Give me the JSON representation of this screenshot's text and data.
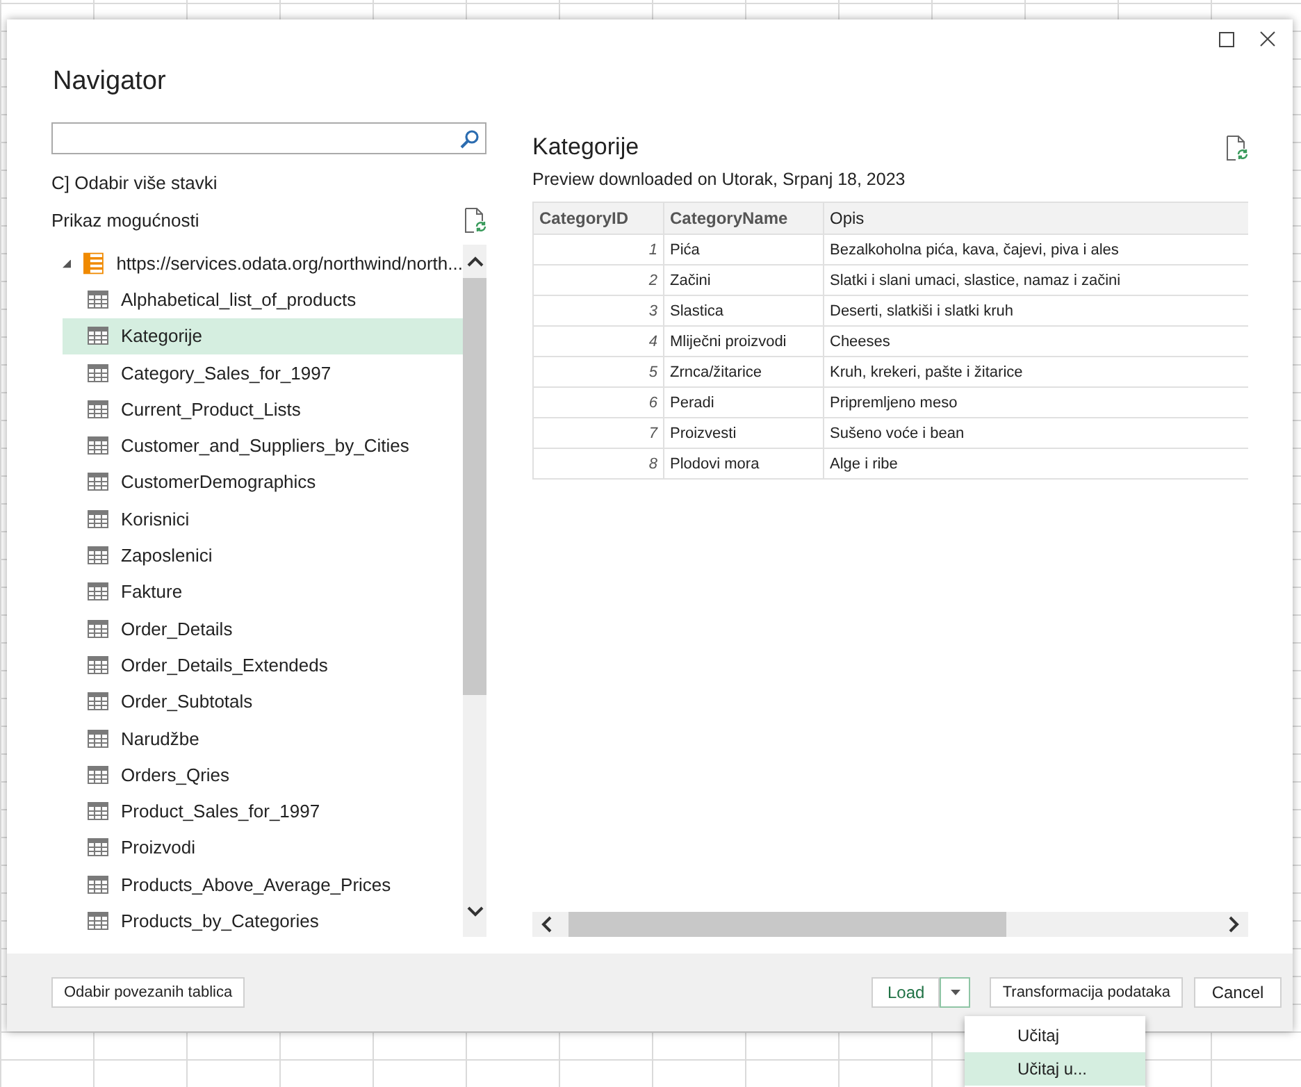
{
  "window": {
    "title": "Navigator"
  },
  "navigator": {
    "multi_select_label": "C] Odabir više stavki",
    "display_options_label": "Prikaz mogućnosti",
    "tree": {
      "label": "https://services.odata.org/northwind/north...",
      "expanded": true,
      "children": [
        {
          "label": "Alphabetical_list_of_products",
          "selected": false
        },
        {
          "label": "Kategorije",
          "selected": true
        },
        {
          "label": "Category_Sales_for_1997",
          "selected": false
        },
        {
          "label": "Current_Product_Lists",
          "selected": false
        },
        {
          "label": "Customer_and_Suppliers_by_Cities",
          "selected": false
        },
        {
          "label": "CustomerDemographics",
          "selected": false
        },
        {
          "label": "Korisnici",
          "selected": false
        },
        {
          "label": "Zaposlenici",
          "selected": false
        },
        {
          "label": "Fakture",
          "selected": false
        },
        {
          "label": "Order_Details",
          "selected": false
        },
        {
          "label": "Order_Details_Extendeds",
          "selected": false
        },
        {
          "label": "Order_Subtotals",
          "selected": false
        },
        {
          "label": "Narudžbe",
          "selected": false
        },
        {
          "label": "Orders_Qries",
          "selected": false
        },
        {
          "label": "Product_Sales_for_1997",
          "selected": false
        },
        {
          "label": "Proizvodi",
          "selected": false
        },
        {
          "label": "Products_Above_Average_Prices",
          "selected": false
        },
        {
          "label": "Products_by_Categories",
          "selected": false
        }
      ]
    }
  },
  "preview": {
    "title": "Kategorije",
    "subtitle": "Preview downloaded on Utorak, Srpanj 18, 2023",
    "table": {
      "columns": [
        "CategoryID",
        "CategoryName",
        "Opis"
      ],
      "rows": [
        [
          "1",
          "Pića",
          "Bezalkoholna pića, kava, čajevi, piva i ales"
        ],
        [
          "2",
          "Začini",
          "Slatki i slani umaci, slastice, namaz i začini"
        ],
        [
          "3",
          "Slastica",
          "Deserti, slatkiši i slatki kruh"
        ],
        [
          "4",
          "Mliječni proizvodi",
          "Cheeses"
        ],
        [
          "5",
          "Zrnca/žitarice",
          "Kruh, krekeri, pašte i žitarice"
        ],
        [
          "6",
          "Peradi",
          "Pripremljeno meso"
        ],
        [
          "7",
          "Proizvesti",
          "Sušeno voće i bean"
        ],
        [
          "8",
          "Plodovi mora",
          "Alge i ribe"
        ]
      ]
    }
  },
  "footer": {
    "select_related": "Odabir povezanih tablica",
    "load": "Load",
    "transform": "Transformacija podataka",
    "cancel": "Cancel"
  },
  "load_menu": {
    "items": [
      {
        "label": "Učitaj",
        "selected": false
      },
      {
        "label": "Učitaj u...",
        "selected": true
      }
    ]
  }
}
